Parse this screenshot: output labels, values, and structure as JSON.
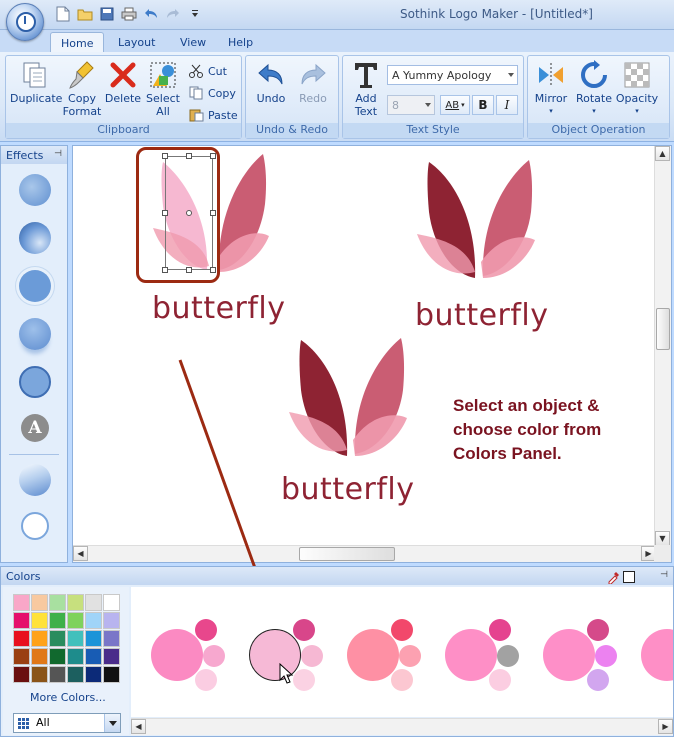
{
  "window": {
    "title": "Sothink Logo Maker - [Untitled*]"
  },
  "tabs": [
    {
      "label": "Home",
      "active": true
    },
    {
      "label": "Layout",
      "active": false
    },
    {
      "label": "View",
      "active": false
    },
    {
      "label": "Help",
      "active": false
    }
  ],
  "ribbon": {
    "clipboard": {
      "label": "Clipboard",
      "duplicate": "Duplicate",
      "copy_format_1": "Copy",
      "copy_format_2": "Format",
      "delete": "Delete",
      "select_all_1": "Select",
      "select_all_2": "All",
      "cut": "Cut",
      "copy": "Copy",
      "paste": "Paste"
    },
    "undo_redo": {
      "label": "Undo & Redo",
      "undo": "Undo",
      "redo": "Redo"
    },
    "text_style": {
      "label": "Text Style",
      "add_text_1": "Add",
      "add_text_2": "Text",
      "font": "A Yummy Apology",
      "size": "8",
      "spacing": "AB",
      "bold": "B",
      "italic": "I"
    },
    "object_operation": {
      "label": "Object Operation",
      "mirror": "Mirror",
      "rotate": "Rotate",
      "opacity": "Opacity"
    }
  },
  "effects": {
    "title": "Effects"
  },
  "canvas": {
    "logo_text_1": "butterfly",
    "logo_text_2": "butterfly",
    "logo_text_3": "butterfly",
    "instructions": [
      "Select an object &",
      "choose color from",
      "Colors Panel."
    ]
  },
  "colors": {
    "title": "Colors",
    "more_colors": "More Colors...",
    "filter": "All",
    "swatches": [
      "#f9a7c8",
      "#f8c9a0",
      "#a8e0a0",
      "#c7e07e",
      "#e1e1e1",
      "#ffffff",
      "#e5106c",
      "#ffe23a",
      "#3fb04a",
      "#7fd25c",
      "#a0d4f8",
      "#b8b4ef",
      "#e8101e",
      "#ffa21a",
      "#2a8c5e",
      "#41c0bc",
      "#1c94d8",
      "#7a76c8",
      "#9a4012",
      "#e07818",
      "#11692e",
      "#1e8c8c",
      "#185cb4",
      "#4a2c8a",
      "#6a1010",
      "#8a5418",
      "#555555",
      "#1c5f5f",
      "#0c2a78",
      "#111111"
    ],
    "schemes": [
      {
        "main": "#fb8ac2",
        "top": "#e8478c",
        "mid": "#f7a8cf",
        "bottom": "#fbcde2"
      },
      {
        "main": "#f6b9d6",
        "top": "#d8468a",
        "mid": "#f6b8d3",
        "bottom": "#fbd2e3"
      },
      {
        "main": "#fe90a4",
        "top": "#f2486b",
        "mid": "#fca1b1",
        "bottom": "#fcc7d1"
      },
      {
        "main": "#fe8fc6",
        "top": "#e5438f",
        "mid": "#a2a2a2",
        "bottom": "#fbcde1"
      },
      {
        "main": "#fe8fc8",
        "top": "#d54a8a",
        "mid": "#ec82f0",
        "bottom": "#d2a6ef"
      },
      {
        "main": "#fe8fc6",
        "top": "#e5438f",
        "mid": "#f7a8cf",
        "bottom": "#fbcde2"
      }
    ]
  },
  "palette": {
    "dark": "#8e2333",
    "medium": "#c7546b",
    "light": "#f09aae",
    "pale": "#f8c2cf",
    "selected": "#f5b4cf",
    "annotation": "#9c2a12"
  }
}
